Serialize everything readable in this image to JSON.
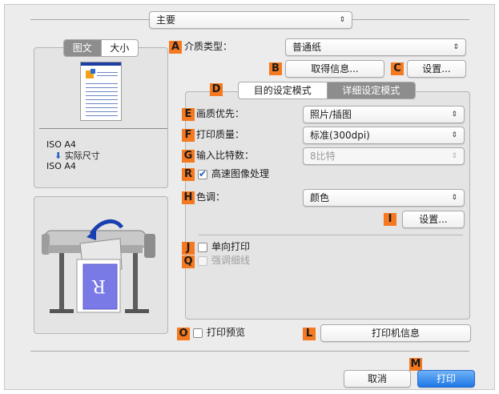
{
  "main_popup": {
    "value": "主要"
  },
  "tabs": [
    {
      "label": "图文"
    },
    {
      "label": "大小"
    }
  ],
  "preview": {
    "paper_from": "ISO A4",
    "scale_note": "实际尺寸",
    "paper_to": "ISO A4"
  },
  "media_type": {
    "badge": "A",
    "label": "介质类型：",
    "value": "普通纸"
  },
  "get_info": {
    "badge": "B",
    "label": "取得信息..."
  },
  "settings_c": {
    "badge": "C",
    "label": "设置..."
  },
  "mode_tabs": {
    "badge": "D",
    "items": [
      {
        "label": "目的设定模式"
      },
      {
        "label": "详细设定模式"
      }
    ]
  },
  "quality_priority": {
    "badge": "E",
    "label": "画质优先：",
    "value": "照片/插图"
  },
  "print_quality": {
    "badge": "F",
    "label": "打印质量：",
    "value": "标准(300dpi)"
  },
  "input_bits": {
    "badge": "G",
    "label": "输入比特数：",
    "value": "8比特"
  },
  "fast_image": {
    "badge": "R",
    "label": "高速图像处理",
    "checked": true
  },
  "color_mode": {
    "badge": "H",
    "label": "色调：",
    "value": "颜色"
  },
  "color_settings": {
    "badge": "I",
    "label": "设置..."
  },
  "unidirectional": {
    "badge": "J",
    "label": "单向打印",
    "checked": false
  },
  "fine_lines": {
    "badge": "Q",
    "label": "强调细线",
    "checked": false
  },
  "print_preview": {
    "badge": "O",
    "label": "打印预览",
    "checked": false
  },
  "printer_info": {
    "badge": "L",
    "label": "打印机信息"
  },
  "footer": {
    "badge": "M",
    "cancel": "取消",
    "print": "打印"
  },
  "icons": {
    "popup_arrows": "⇕",
    "down_arrow": "⬇"
  },
  "colors": {
    "badge": "#f47920",
    "primary_button": "#1f78e5",
    "dialog_bg": "#ececec"
  }
}
